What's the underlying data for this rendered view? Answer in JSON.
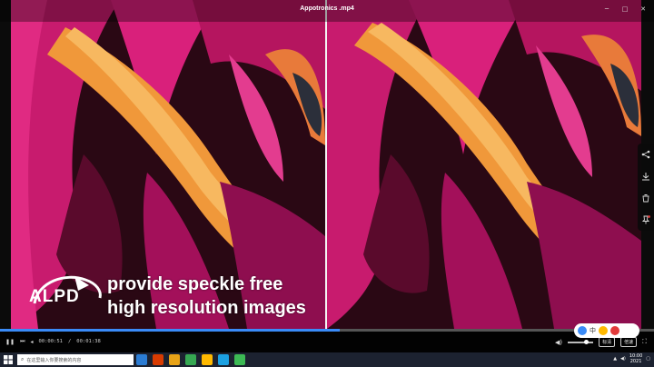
{
  "window": {
    "title": "Appotronics .mp4",
    "controls": [
      "minimize-icon",
      "maximize-icon",
      "close-icon"
    ]
  },
  "video": {
    "caption_line1": "provide speckle free",
    "caption_line2": "high resolution images",
    "logo_text": "ALPD"
  },
  "playback": {
    "current_time": "00:00:51",
    "total_time": "00:01:38",
    "progress_fraction": 0.52,
    "volume_fraction": 0.65,
    "quality_label": "标清",
    "speed_label": "倍速",
    "icons": [
      "pause-icon",
      "next-icon",
      "volume-icon",
      "fullscreen-icon"
    ]
  },
  "right_rail": {
    "icons": [
      "share-icon",
      "download-icon",
      "delete-icon",
      "pin-icon"
    ]
  },
  "taskbar": {
    "search_placeholder": "在这里输入你要搜索的内容",
    "clock_time": "10:00",
    "clock_date": "2021",
    "app_colors": [
      "#2b7cd3",
      "#d83b01",
      "#e8a317",
      "#36a852",
      "#ffb900",
      "#1ba1e2",
      "#3cba54"
    ]
  },
  "ime": {
    "label": "中"
  },
  "colors": {
    "progress": "#3a8bf7",
    "petal_magenta": "#d4207a",
    "petal_orange": "#f0a040"
  }
}
